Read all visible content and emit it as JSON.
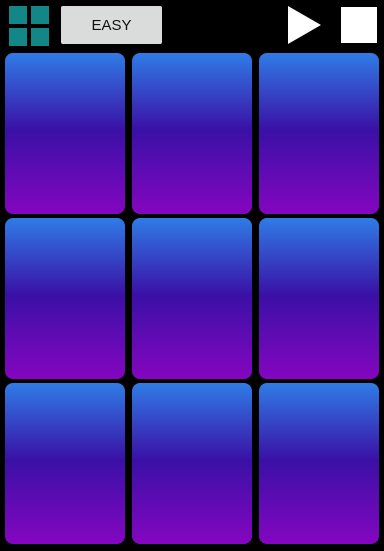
{
  "toolbar": {
    "mode_label": "EASY",
    "menu_icon": "grid-icon",
    "play_icon": "play-icon",
    "stop_icon": "stop-icon"
  },
  "pads": {
    "rows": 3,
    "columns": 3,
    "count": 9
  },
  "colors": {
    "background": "#000000",
    "grid_icon": "#138787",
    "mode_button_bg": "#DADCDC",
    "control_icons": "#FFFFFF",
    "pad_gradient_top": "#2F7CE6",
    "pad_gradient_middle": "#3A10A6",
    "pad_gradient_bottom": "#8406C0"
  }
}
